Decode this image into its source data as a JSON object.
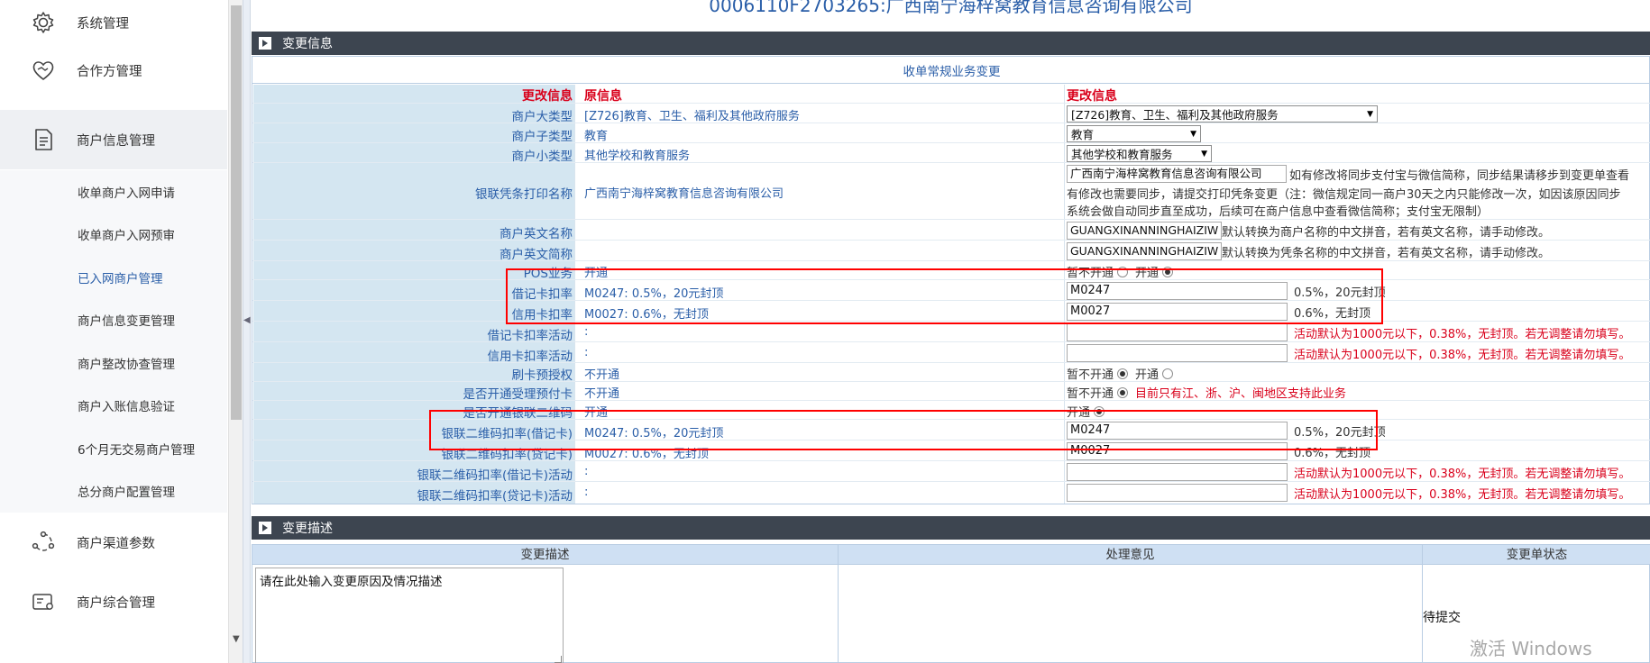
{
  "sidebar": {
    "menu": [
      {
        "label": "系统管理",
        "icon": "gear-icon"
      },
      {
        "label": "合作方管理",
        "icon": "handshake-icon"
      },
      {
        "label": "商户信息管理",
        "icon": "document-icon"
      },
      {
        "label": "商户渠道参数",
        "icon": "network-icon"
      },
      {
        "label": "商户综合管理",
        "icon": "id-card-icon"
      }
    ],
    "submenu": [
      {
        "label": "收单商户入网申请"
      },
      {
        "label": "收单商户入网预审"
      },
      {
        "label": "已入网商户管理"
      },
      {
        "label": "商户信息变更管理"
      },
      {
        "label": "商户整改协查管理"
      },
      {
        "label": "商户入账信息验证"
      },
      {
        "label": "6个月无交易商户管理"
      },
      {
        "label": "总分商户配置管理"
      }
    ]
  },
  "page": {
    "title": "0006110F2703265:广西南宁海梓窝教育信息咨询有限公司"
  },
  "change_info": {
    "section_title": "变更信息",
    "panel_title": "收单常规业务变更",
    "headers": {
      "label": "更改信息",
      "original": "原信息",
      "new": "更改信息"
    },
    "rows": {
      "major_type": {
        "label": "商户大类型",
        "original": "[Z726]教育、卫生、福利及其他政府服务",
        "new": "[Z726]教育、卫生、福利及其他政府服务"
      },
      "sub_type": {
        "label": "商户子类型",
        "original": "教育",
        "new": "教育"
      },
      "minor_type": {
        "label": "商户小类型",
        "original": "其他学校和教育服务",
        "new": "其他学校和教育服务"
      },
      "print_name": {
        "label": "银联凭条打印名称",
        "original": "广西南宁海梓窝教育信息咨询有限公司",
        "new": "广西南宁海梓窝教育信息咨询有限公司",
        "hint1": "如有修改将同步支付宝与微信简称，同步结果请移步到变更单查看",
        "hint2": "有修改也需要同步，请提交打印凭条变更（注：微信规定同一商户30天之内只能修改一次，如因该原因同步",
        "hint3": "系统会做自动同步直至成功，后续可在商户信息中查看微信简称；支付宝无限制）"
      },
      "english_name": {
        "label": "商户英文名称",
        "original": "",
        "new": "GUANGXINANNINGHAIZIW",
        "hint": "默认转换为商户名称的中文拼音，若有英文名称，请手动修改。"
      },
      "english_short": {
        "label": "商户英文简称",
        "original": "",
        "new": "GUANGXINANNINGHAIZIW",
        "hint": "默认转换为凭条名称的中文拼音，若有英文名称，请手动修改。"
      },
      "pos": {
        "label": "POS业务",
        "original": "开通",
        "opt_off": "暂不开通",
        "opt_on": "开通"
      },
      "debit_rate": {
        "label": "借记卡扣率",
        "original": "M0247: 0.5%，20元封顶",
        "new": "M0247",
        "desc": "0.5%，20元封顶"
      },
      "credit_rate": {
        "label": "信用卡扣率",
        "original": "M0027: 0.6%，无封顶",
        "new": "M0027",
        "desc": "0.6%，无封顶"
      },
      "debit_promo": {
        "label": "借记卡扣率活动",
        "original": ":",
        "new": "",
        "note": "活动默认为1000元以下，0.38%，无封顶。若无调整请勿填写。"
      },
      "credit_promo": {
        "label": "信用卡扣率活动",
        "original": ":",
        "new": "",
        "note": "活动默认为1000元以下，0.38%，无封顶。若无调整请勿填写。"
      },
      "preauth": {
        "label": "刷卡预授权",
        "original": "不开通",
        "opt_off": "暂不开通",
        "opt_on": "开通"
      },
      "prepaid": {
        "label": "是否开通受理预付卡",
        "original": "不开通",
        "opt_off": "暂不开通",
        "note": "目前只有江、浙、沪、闽地区支持此业务"
      },
      "unionpay_qr": {
        "label": "是否开通银联二维码",
        "original": "开通",
        "opt_on": "开通"
      },
      "qr_debit_rate": {
        "label": "银联二维码扣率(借记卡)",
        "original": "M0247: 0.5%，20元封顶",
        "new": "M0247",
        "desc": "0.5%，20元封顶"
      },
      "qr_credit_rate": {
        "label": "银联二维码扣率(贷记卡)",
        "original": "M0027: 0.6%，无封顶",
        "new": "M0027",
        "desc": "0.6%，无封顶"
      },
      "qr_debit_promo": {
        "label": "银联二维码扣率(借记卡)活动",
        "original": ":",
        "new": "",
        "note": "活动默认为1000元以下，0.38%，无封顶。若无调整请勿填写。"
      },
      "qr_credit_promo": {
        "label": "银联二维码扣率(贷记卡)活动",
        "original": ":",
        "new": "",
        "note": "活动默认为1000元以下，0.38%，无封顶。若无调整请勿填写。"
      }
    }
  },
  "change_desc": {
    "section_title": "变更描述",
    "columns": [
      "变更描述",
      "处理意见",
      "变更单状态"
    ],
    "placeholder": "请在此处输入变更原因及情况描述",
    "status": "待提交"
  },
  "watermark": "激活 Windows",
  "colors": {
    "accent": "#2a5ea8",
    "warning": "#d9001b",
    "section_bar": "#3d4550",
    "label_bg": "#d4e6f1",
    "annotation": "#ff0000"
  }
}
